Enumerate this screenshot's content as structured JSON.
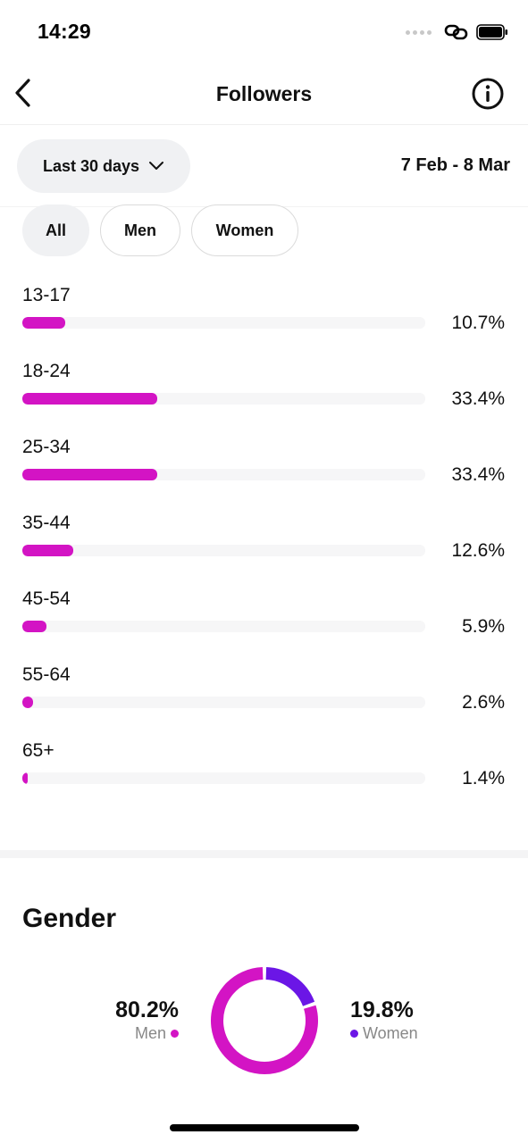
{
  "status_bar": {
    "time": "14:29"
  },
  "header": {
    "title": "Followers"
  },
  "filters": {
    "period_label": "Last 30 days",
    "date_range": "7 Feb - 8 Mar",
    "segments": [
      "All",
      "Men",
      "Women"
    ],
    "selected_segment": "All"
  },
  "age_distribution": [
    {
      "range": "13-17",
      "value": "10.7%",
      "fraction": 0.107
    },
    {
      "range": "18-24",
      "value": "33.4%",
      "fraction": 0.334
    },
    {
      "range": "25-34",
      "value": "33.4%",
      "fraction": 0.334
    },
    {
      "range": "35-44",
      "value": "12.6%",
      "fraction": 0.126
    },
    {
      "range": "45-54",
      "value": "5.9%",
      "fraction": 0.059
    },
    {
      "range": "55-64",
      "value": "2.6%",
      "fraction": 0.026
    },
    {
      "range": "65+",
      "value": "1.4%",
      "fraction": 0.014
    }
  ],
  "gender": {
    "title": "Gender",
    "men": {
      "label": "Men",
      "value": "80.2%",
      "fraction": 0.802
    },
    "women": {
      "label": "Women",
      "value": "19.8%",
      "fraction": 0.198
    }
  },
  "colors": {
    "accent_magenta": "#d314c4",
    "accent_purple": "#6b16e6",
    "track": "#f6f6f7",
    "chip_bg": "#f0f1f3"
  },
  "icons": {
    "back": "chevron-left-icon",
    "info": "info-icon",
    "dropdown": "chevron-down-icon"
  }
}
